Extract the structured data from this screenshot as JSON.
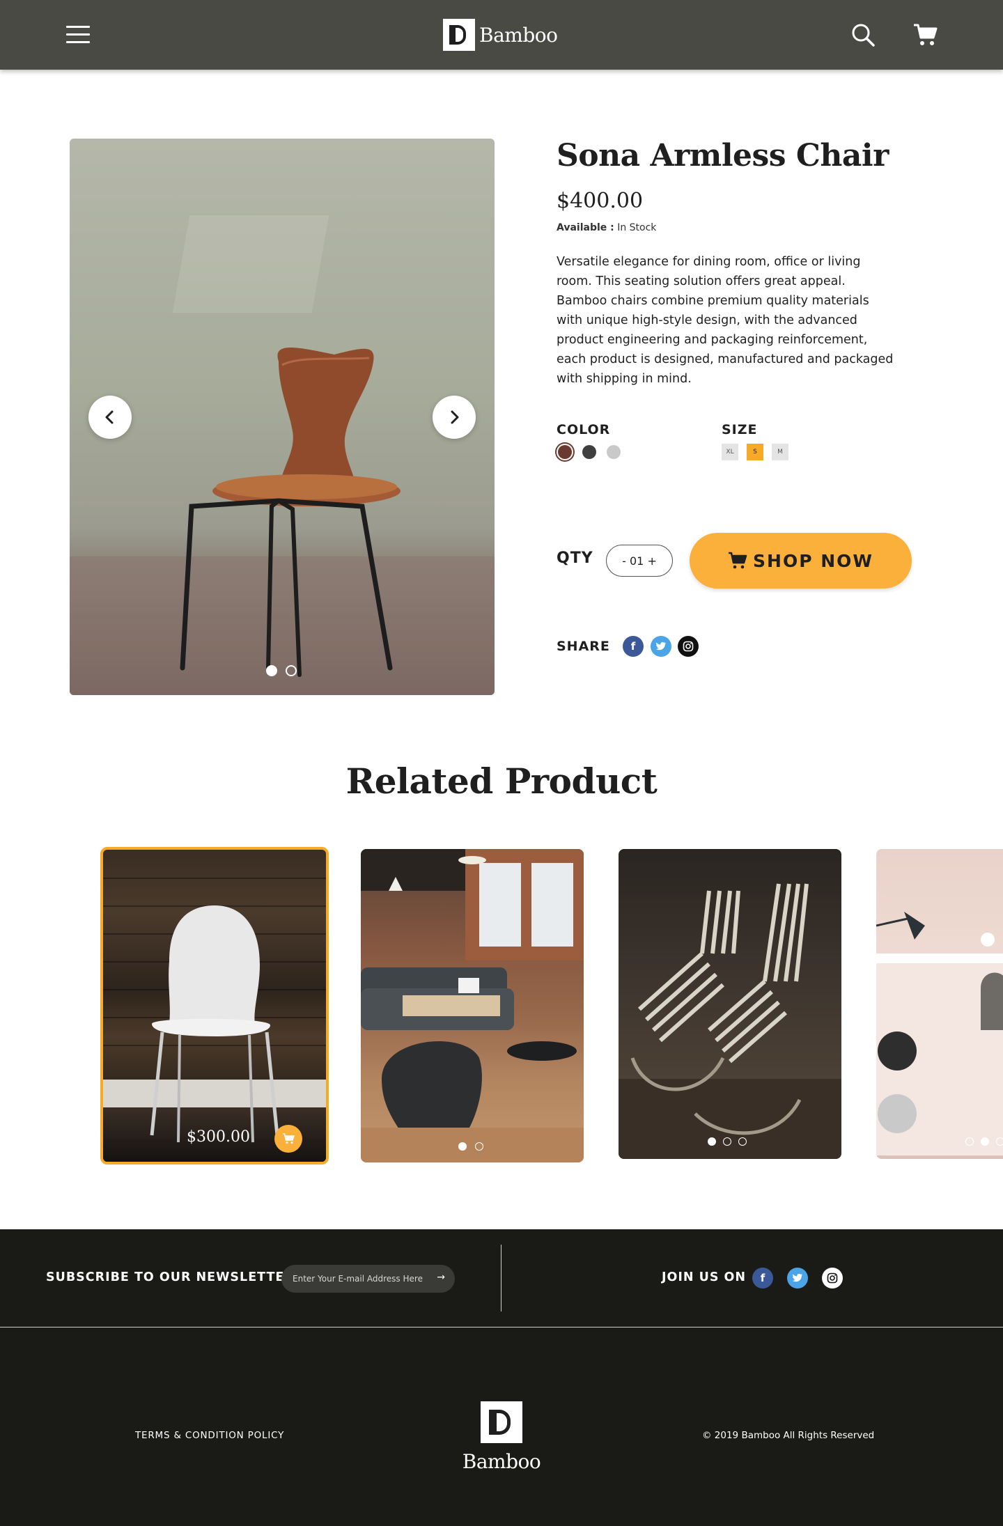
{
  "header": {
    "brand": "Bamboo",
    "menu_icon": "hamburger-menu-icon",
    "search_icon": "search-icon",
    "cart_icon": "cart-icon"
  },
  "product": {
    "title": "Sona Armless Chair",
    "price": "$400.00",
    "availability_label": "Available :",
    "availability_value": "In Stock",
    "description": "Versatile elegance for dining room, office or living room. This seating solution offers great appeal. Bamboo chairs combine premium quality materials with unique high-style design, with the advanced product engineering and packaging reinforcement, each product is designed, manufactured and packaged with shipping in mind.",
    "gallery": {
      "slides": 2,
      "active_slide": 1
    },
    "color_label": "COLOR",
    "colors": [
      "#6b3a2e",
      "#3f3f40",
      "#c9c9c9"
    ],
    "selected_color": "#6b3a2e",
    "size_label": "SIZE",
    "sizes": [
      "XL",
      "S",
      "M"
    ],
    "selected_size": "S",
    "qty_label": "QTY",
    "qty_value": "- 01 +",
    "shop_button": "SHOP NOW",
    "share_label": "SHARE"
  },
  "related": {
    "title": "Related Product",
    "cards": [
      {
        "price": "$300.00",
        "highlighted": true
      },
      {
        "dots": 2,
        "active_dot": 1
      },
      {
        "dots": 3,
        "active_dot": 1
      },
      {
        "dots": 3,
        "active_dot": 2
      }
    ]
  },
  "footer": {
    "newsletter_label": "SUBSCRIBE TO OUR NEWSLETTER",
    "email_placeholder": "Enter Your E-mail Address Here",
    "join_label": "JOIN US ON",
    "terms": "TERMS & CONDITION POLICY",
    "brand": "Bamboo",
    "copyright": "© 2019 Bamboo All Rights Reserved"
  },
  "colors": {
    "header_bg": "#4a4a45",
    "accent": "#fbb03b",
    "footer_bg": "#1a1b16",
    "facebook": "#3b5998",
    "twitter": "#4ba3e8",
    "instagram": "#111111"
  }
}
